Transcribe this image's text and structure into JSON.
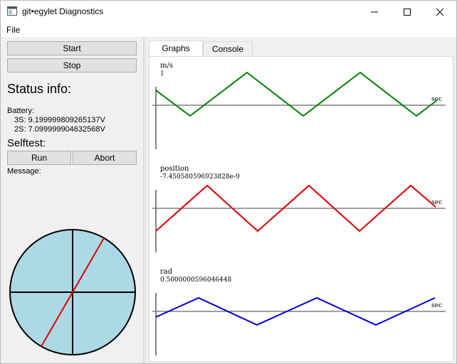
{
  "window": {
    "title": "git•egylet Diagnostics"
  },
  "menu": {
    "file": "File"
  },
  "controls": {
    "start": "Start",
    "stop": "Stop"
  },
  "status": {
    "heading": "Status info:",
    "battery_label": "Battery:",
    "battery_3s": "3S: 9.199999809265137V",
    "battery_2s": "2S: 7.099999904632568V"
  },
  "selftest": {
    "heading": "Selftest:",
    "run": "Run",
    "abort": "Abort",
    "message_label": "Message:"
  },
  "gauge": {
    "needle_angle_deg": 30,
    "fill_color": "#add8e6",
    "needle_color": "#e00000"
  },
  "tabs": {
    "graphs": "Graphs",
    "console": "Console"
  },
  "graphs": [
    {
      "unit": "m/s",
      "value": "1",
      "axis_label": "sec",
      "color": "#008000"
    },
    {
      "unit": "position",
      "value": "-7.450580596923828e-9",
      "axis_label": "sec",
      "color": "#e00000"
    },
    {
      "unit": "rad",
      "value": "0.5000000596046448",
      "axis_label": "sec",
      "color": "#0000cc"
    }
  ]
}
